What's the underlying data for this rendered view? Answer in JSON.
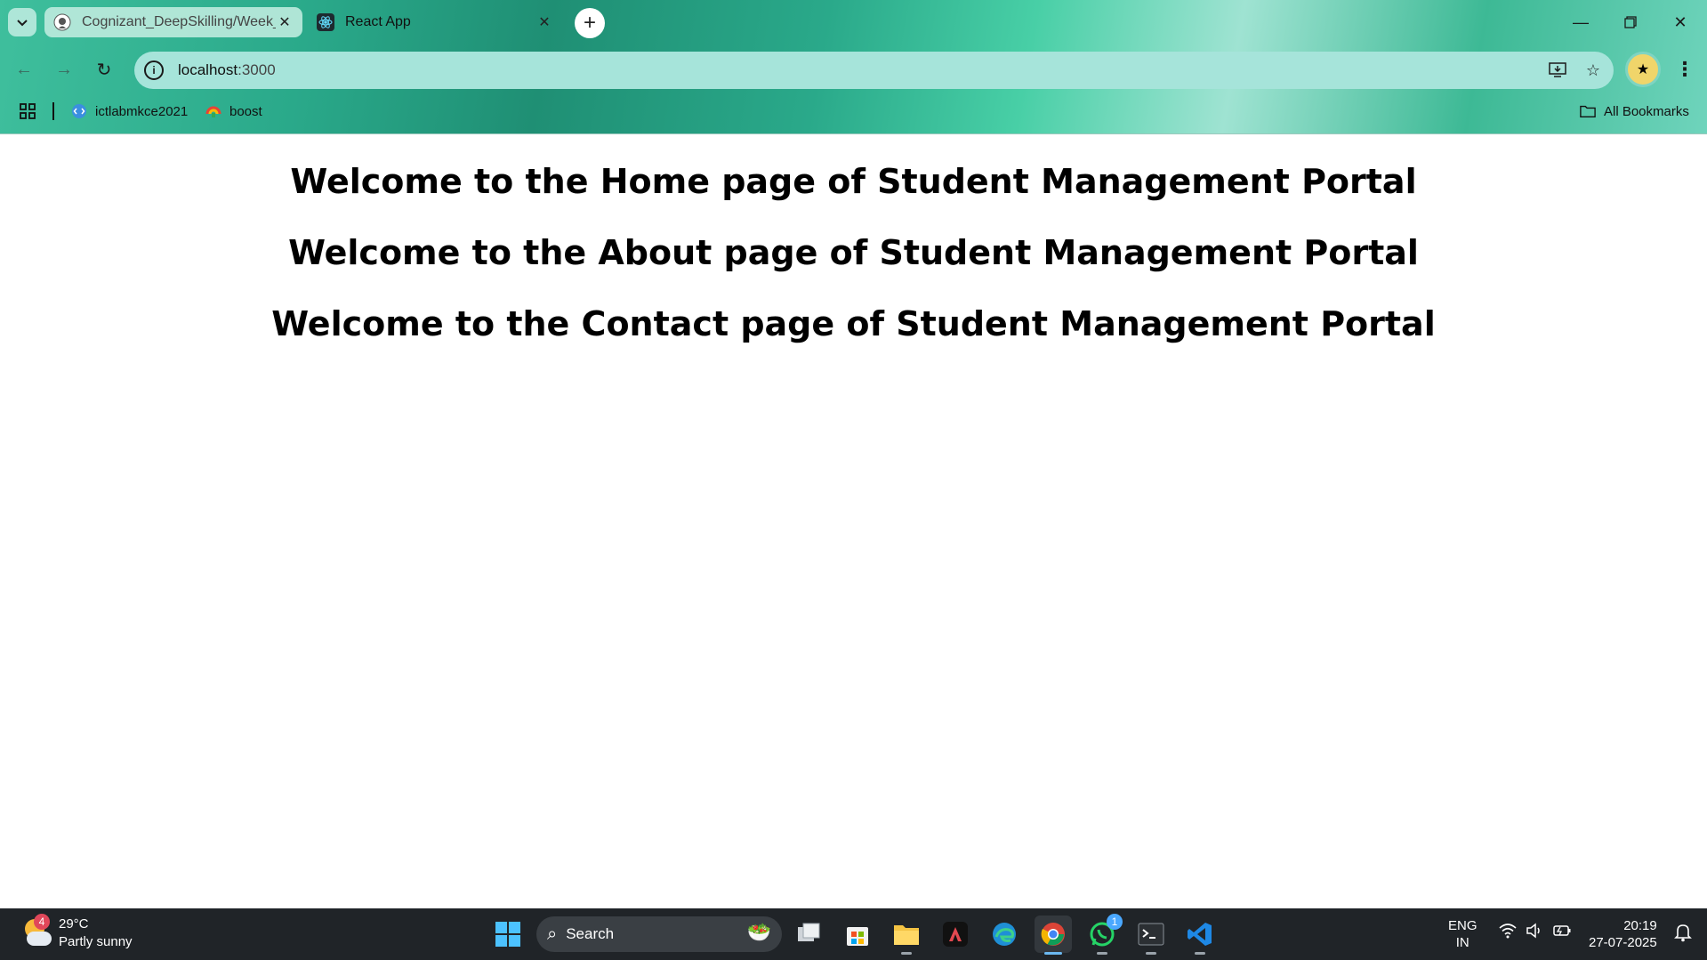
{
  "browser": {
    "tabs": [
      {
        "title": "Cognizant_DeepSkilling/Week_",
        "icon": "github-icon",
        "active": false
      },
      {
        "title": "React App",
        "icon": "react-icon",
        "active": true
      }
    ],
    "address": {
      "host": "localhost",
      "port": ":3000"
    },
    "bookmarks": [
      {
        "label": "ictlabmkce2021",
        "icon": "code-icon"
      },
      {
        "label": "boost",
        "icon": "boost-icon"
      }
    ],
    "all_bookmarks_label": "All Bookmarks"
  },
  "page": {
    "headings": [
      "Welcome to the Home page of Student Management Portal",
      "Welcome to the About page of Student Management Portal",
      "Welcome to the Contact page of Student Management Portal"
    ]
  },
  "taskbar": {
    "weather": {
      "temp": "29°C",
      "condition": "Partly sunny",
      "badge": "4"
    },
    "search_label": "Search",
    "whatsapp_badge": "1",
    "language": {
      "line1": "ENG",
      "line2": "IN"
    },
    "clock": {
      "time": "20:19",
      "date": "27-07-2025"
    }
  },
  "colors": {
    "chrome_accent": "#2aa98a",
    "omnibox": "#a6e4da",
    "taskbar": "#202428"
  }
}
